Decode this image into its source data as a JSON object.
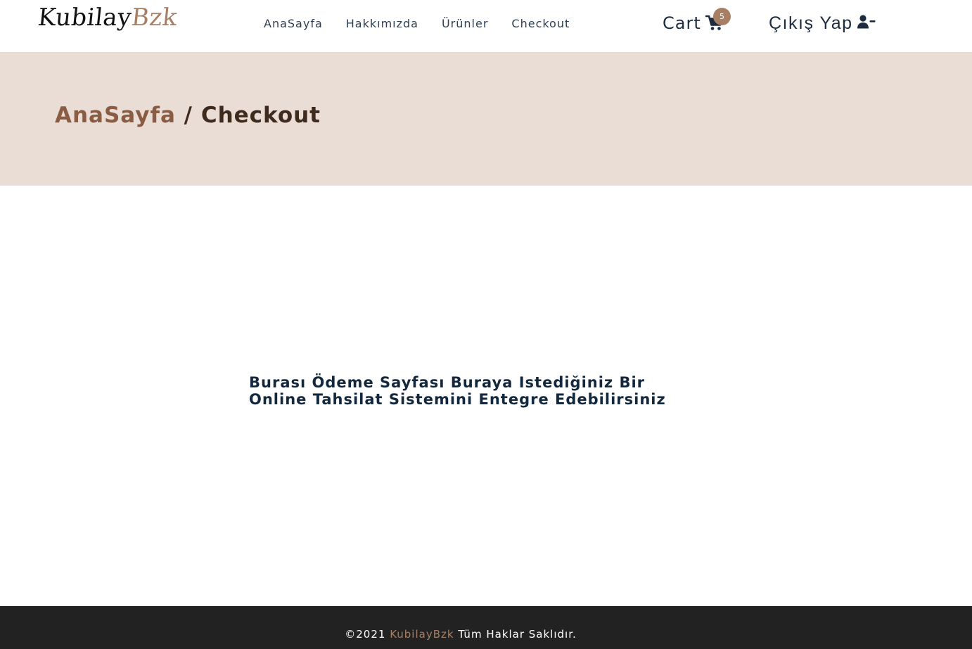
{
  "header": {
    "logo": {
      "main": "Kubilay",
      "accent": "Bzk"
    },
    "nav": [
      {
        "label": "AnaSayfa"
      },
      {
        "label": "Hakkımızda"
      },
      {
        "label": "Ürünler"
      },
      {
        "label": "Checkout"
      }
    ],
    "cart": {
      "label": "Cart",
      "count": "5",
      "icon": "shopping-cart-icon"
    },
    "logout": {
      "label": "Çıkış Yap",
      "icon": "user-minus-icon"
    }
  },
  "breadcrumb": {
    "home": "AnaSayfa",
    "separator": " / ",
    "current": "Checkout"
  },
  "main": {
    "message": "Burası Ödeme Sayfası Buraya Istediğiniz Bir Online Tahsilat Sistemini Entegre Edebilirsiniz"
  },
  "footer": {
    "copyright": "©2021 ",
    "brand": "KubilayBzk",
    "rights": " Tüm Haklar Saklıdır."
  },
  "colors": {
    "accent": "#a77f65",
    "navy": "#14283d",
    "banner_bg": "#eaddd5",
    "footer_bg": "#222222"
  }
}
